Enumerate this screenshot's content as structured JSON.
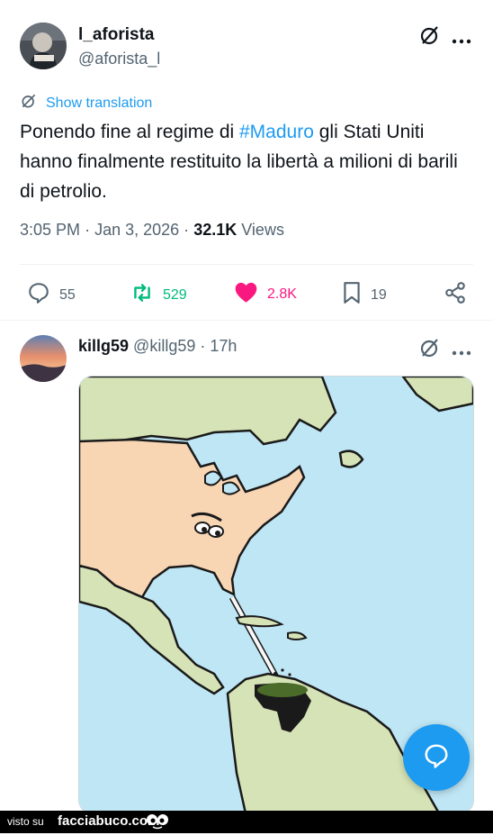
{
  "tweet": {
    "author_name": "l_aforista",
    "author_handle": "@aforista_l",
    "show_translation": "Show translation",
    "text_before": "Ponendo fine al regime di ",
    "hashtag": "#Maduro",
    "text_after": " gli Stati Uniti hanno finalmente restituito la libertà a milioni di barili di petrolio.",
    "time": "3:05 PM",
    "date": "Jan 3, 2026",
    "views_count": "32.1K",
    "views_label": "Views",
    "separator": "·",
    "stats": {
      "replies": "55",
      "retweets": "529",
      "likes": "2.8K",
      "bookmarks": "19"
    }
  },
  "reply": {
    "author_name": "killg59",
    "author_handle": "@killg59",
    "separator": "·",
    "age": "17h"
  },
  "footer": {
    "visto_su": "visto su",
    "brand": "facciabuco.com"
  },
  "colors": {
    "accent": "#1d9bf0",
    "retweet": "#00ba7c",
    "like": "#f91880",
    "ocean": "#bfe6f5",
    "land_us": "#f8d6b4",
    "land_other": "#d6e3b6",
    "oil": "#1a1a1a"
  }
}
